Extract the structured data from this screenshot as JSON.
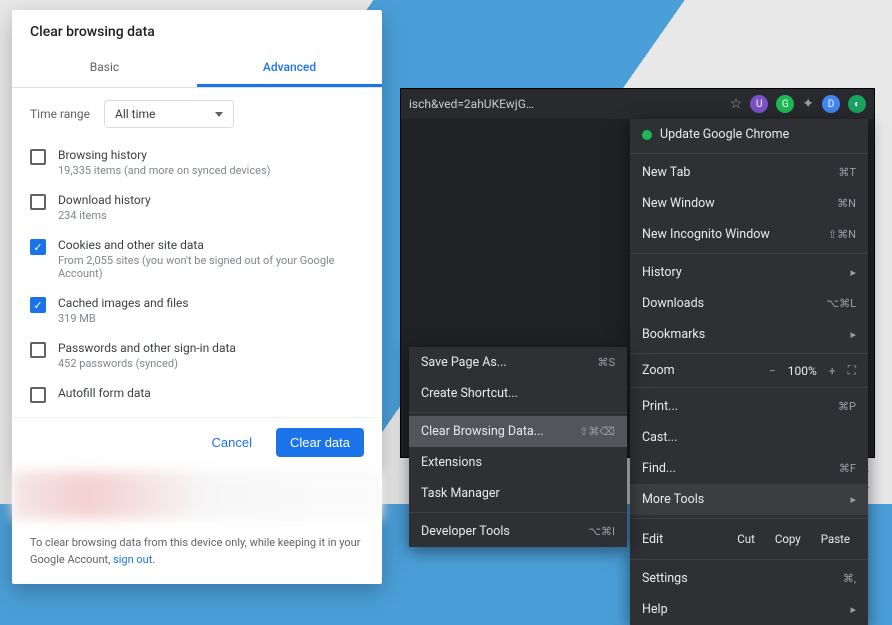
{
  "dialog": {
    "title": "Clear browsing data",
    "tabs": {
      "basic": "Basic",
      "advanced": "Advanced"
    },
    "time_range_label": "Time range",
    "time_range_value": "All time",
    "items": [
      {
        "title": "Browsing history",
        "sub": "19,335 items (and more on synced devices)",
        "checked": false
      },
      {
        "title": "Download history",
        "sub": "234 items",
        "checked": false
      },
      {
        "title": "Cookies and other site data",
        "sub": "From 2,055 sites (you won't be signed out of your Google Account)",
        "checked": true
      },
      {
        "title": "Cached images and files",
        "sub": "319 MB",
        "checked": true
      },
      {
        "title": "Passwords and other sign-in data",
        "sub": "452 passwords (synced)",
        "checked": false
      },
      {
        "title": "Autofill form data",
        "sub": "",
        "checked": false
      }
    ],
    "actions": {
      "cancel": "Cancel",
      "clear": "Clear data"
    },
    "footer_text": "To clear browsing data from this device only, while keeping it in your Google Account, ",
    "footer_link": "sign out"
  },
  "address_bar": {
    "url": "isch&ved=2ahUKEwjG…"
  },
  "main_menu": {
    "update": "Update Google Chrome",
    "items1": [
      {
        "label": "New Tab",
        "shortcut": "⌘T"
      },
      {
        "label": "New Window",
        "shortcut": "⌘N"
      },
      {
        "label": "New Incognito Window",
        "shortcut": "⇧⌘N"
      }
    ],
    "items2": [
      {
        "label": "History",
        "arrow": true
      },
      {
        "label": "Downloads",
        "shortcut": "⌥⌘L"
      },
      {
        "label": "Bookmarks",
        "arrow": true
      }
    ],
    "zoom": {
      "label": "Zoom",
      "value": "100%"
    },
    "items3": [
      {
        "label": "Print...",
        "shortcut": "⌘P"
      },
      {
        "label": "Cast..."
      },
      {
        "label": "Find...",
        "shortcut": "⌘F"
      },
      {
        "label": "More Tools",
        "arrow": true,
        "hover": true
      }
    ],
    "edit": {
      "label": "Edit",
      "cut": "Cut",
      "copy": "Copy",
      "paste": "Paste"
    },
    "items4": [
      {
        "label": "Settings",
        "shortcut": "⌘,"
      },
      {
        "label": "Help",
        "arrow": true
      }
    ]
  },
  "sub_menu": {
    "items": [
      {
        "label": "Save Page As...",
        "shortcut": "⌘S"
      },
      {
        "label": "Create Shortcut..."
      },
      {
        "sep": true
      },
      {
        "label": "Clear Browsing Data...",
        "shortcut": "⇧⌘⌫",
        "hover": true
      },
      {
        "label": "Extensions"
      },
      {
        "label": "Task Manager"
      },
      {
        "sep": true
      },
      {
        "label": "Developer Tools",
        "shortcut": "⌥⌘I"
      }
    ]
  },
  "watermark": "UGETFIX"
}
